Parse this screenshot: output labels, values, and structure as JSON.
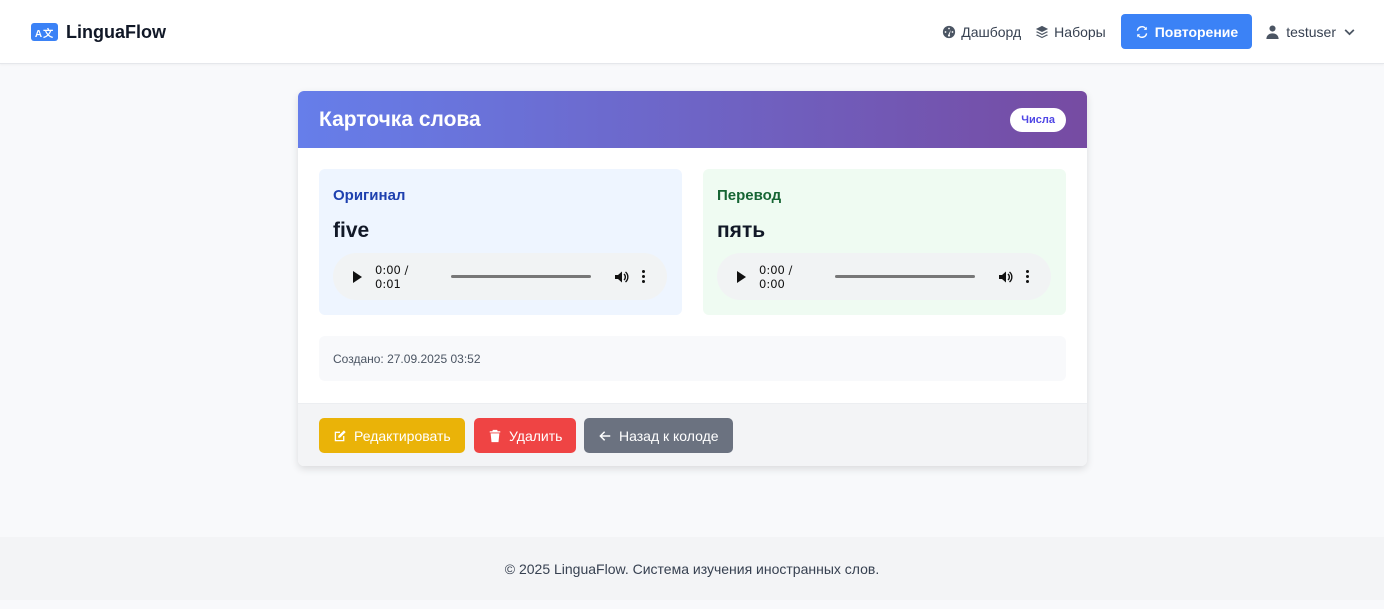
{
  "navbar": {
    "brand_icon_text": "A文",
    "brand": "LinguaFlow",
    "links": [
      {
        "label": "Дашборд",
        "icon": "dashboard-icon"
      },
      {
        "label": "Наборы",
        "icon": "layers-icon"
      }
    ],
    "review_label": "Повторение",
    "review_icon": "sync-icon",
    "username": "testuser"
  },
  "card": {
    "title": "Карточка слова",
    "tag": "Числа",
    "original": {
      "label": "Оригинал",
      "word": "five",
      "audio_time": "0:00 / 0:01"
    },
    "translation": {
      "label": "Перевод",
      "word": "пять",
      "audio_time": "0:00 / 0:00"
    },
    "created": "Создано: 27.09.2025 03:52",
    "buttons": {
      "edit": "Редактировать",
      "delete": "Удалить",
      "back": "Назад к колоде"
    }
  },
  "footer": {
    "text": "© 2025 LinguaFlow. Система изучения иностранных слов."
  },
  "colors": {
    "primary": "#3b82f6",
    "header_gradient_start": "#667eea",
    "header_gradient_end": "#764ba2",
    "edit": "#eab308",
    "delete": "#ef4444",
    "back": "#6b7280"
  }
}
